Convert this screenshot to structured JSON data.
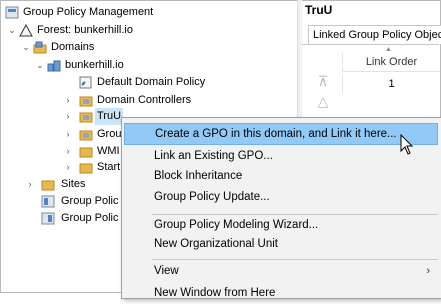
{
  "tree": {
    "root": "Group Policy Management",
    "forest": "Forest: bunkerhill.io",
    "domains": "Domains",
    "domain": "bunkerhill.io",
    "children": [
      "Default Domain Policy",
      "Domain Controllers",
      "TruU",
      "Grou",
      "WMI",
      "Start"
    ],
    "sites": "Sites",
    "gp1": "Group Polic",
    "gp2": "Group Polic"
  },
  "right_pane": {
    "title": "TruU",
    "tab": "Linked Group Policy Objects",
    "column_header": "Link Order",
    "first_cell": "1"
  },
  "context_menu": {
    "items": [
      "Create a GPO in this domain, and Link it here...",
      "Link an Existing GPO...",
      "Block Inheritance",
      "Group Policy Update...",
      "Group Policy Modeling Wizard...",
      "New Organizational Unit",
      "View",
      "New Window from Here"
    ],
    "highlighted_index": 0
  },
  "colors": {
    "selection": "#cce4f7",
    "menu_highlight": "#91c9f7",
    "menu_bg": "#f2f2f2",
    "folder": "#e8b84a"
  }
}
